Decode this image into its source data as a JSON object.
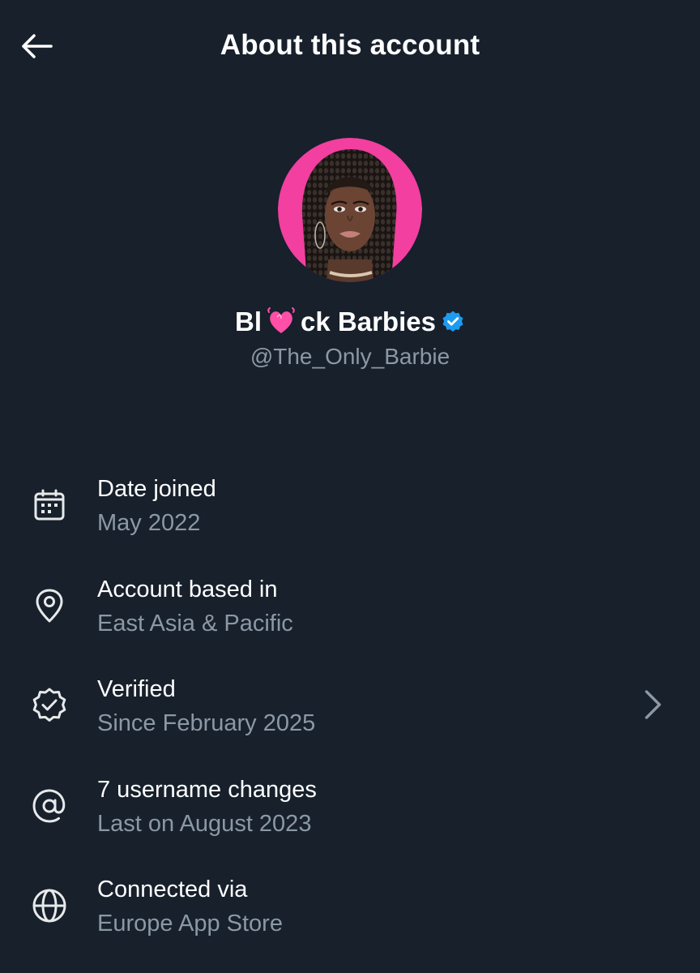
{
  "header": {
    "title": "About this account"
  },
  "profile": {
    "name_prefix": "Bl",
    "name_suffix": "ck Barbies",
    "handle": "@The_Only_Barbie"
  },
  "info": [
    {
      "label": "Date joined",
      "value": "May 2022",
      "icon": "calendar-icon"
    },
    {
      "label": "Account based in",
      "value": "East Asia & Pacific",
      "icon": "location-pin-icon"
    },
    {
      "label": "Verified",
      "value": "Since February 2025",
      "icon": "verified-badge-icon"
    },
    {
      "label": "7 username changes",
      "value": "Last on August 2023",
      "icon": "at-sign-icon"
    },
    {
      "label": "Connected via",
      "value": "Europe App Store",
      "icon": "globe-icon"
    }
  ],
  "colors": {
    "background": "#17202b",
    "text_primary": "#ffffff",
    "text_secondary": "#8b98a5",
    "verified_blue": "#1d9bf0",
    "avatar_ring": "#f23fa0",
    "heart_pink": "#ff4fa7"
  }
}
